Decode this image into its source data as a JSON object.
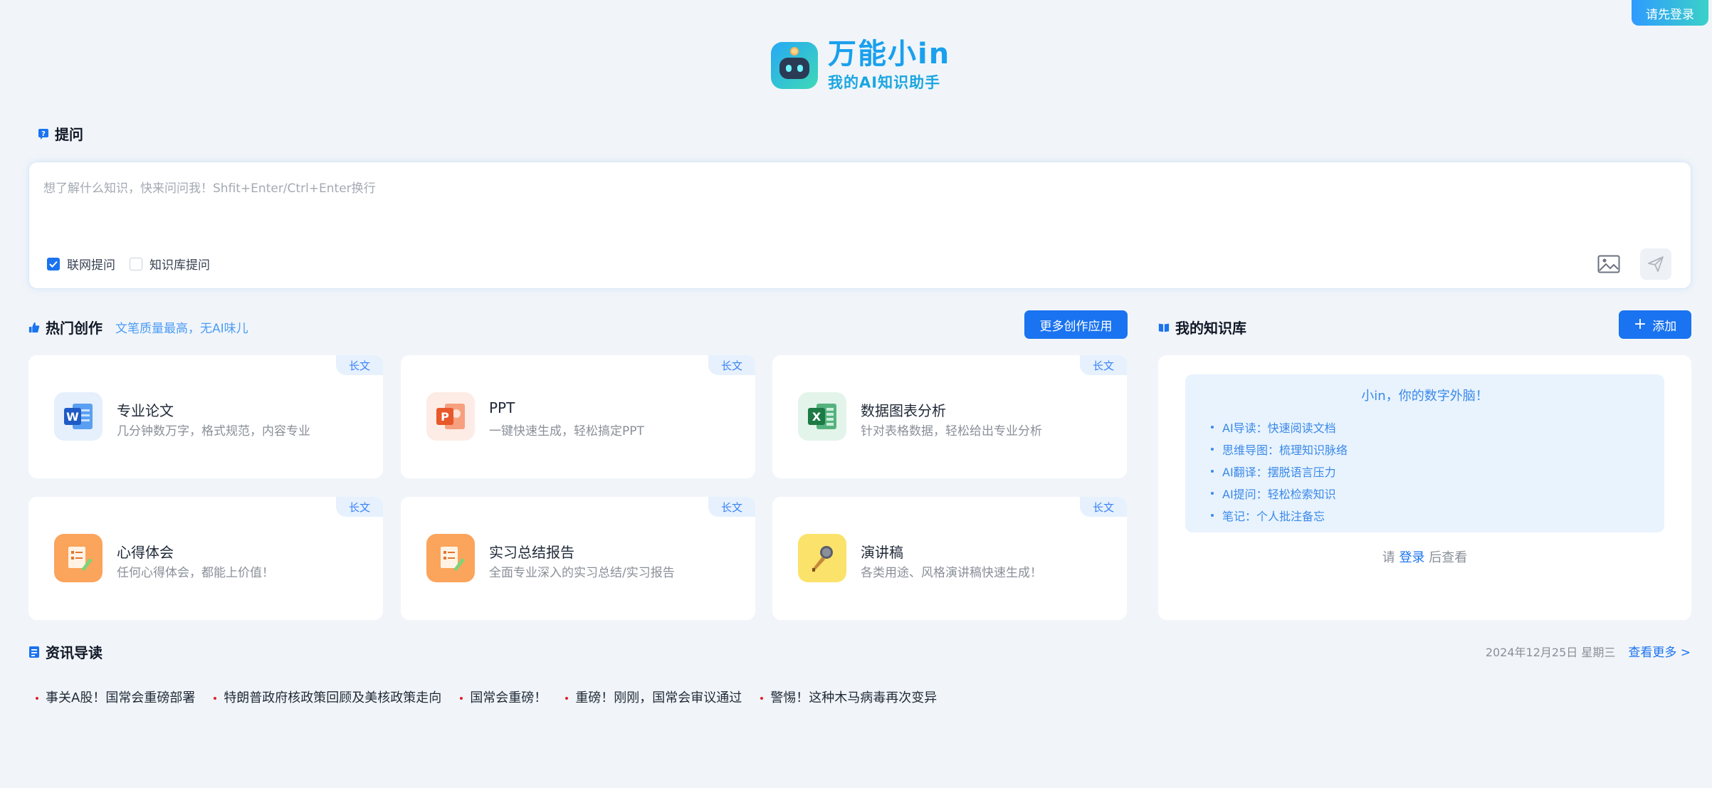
{
  "header": {
    "login_button": "请先登录",
    "logo_title": "万能小in",
    "logo_subtitle": "我的AI知识助手"
  },
  "ask": {
    "section_title": "提问",
    "placeholder": "想了解什么知识，快来问问我！Shfit+Enter/Ctrl+Enter换行",
    "options": [
      {
        "label": "联网提问",
        "checked": true
      },
      {
        "label": "知识库提问",
        "checked": false
      }
    ]
  },
  "hot": {
    "section_title": "热门创作",
    "subtitle": "文笔质量最高，无AI味儿",
    "more_button": "更多创作应用",
    "cards": [
      {
        "tag": "长文",
        "title": "专业论文",
        "desc": "几分钟数万字，格式规范，内容专业",
        "icon": "word-icon"
      },
      {
        "tag": "长文",
        "title": "PPT",
        "desc": "一键快速生成，轻松搞定PPT",
        "icon": "ppt-icon"
      },
      {
        "tag": "长文",
        "title": "数据图表分析",
        "desc": "针对表格数据，轻松给出专业分析",
        "icon": "excel-icon"
      },
      {
        "tag": "长文",
        "title": "心得体会",
        "desc": "任何心得体会，都能上价值！",
        "icon": "document-pen-icon"
      },
      {
        "tag": "长文",
        "title": "实习总结报告",
        "desc": "全面专业深入的实习总结/实习报告",
        "icon": "document-pen-icon"
      },
      {
        "tag": "长文",
        "title": "演讲稿",
        "desc": "各类用途、风格演讲稿快速生成！",
        "icon": "microphone-icon"
      }
    ]
  },
  "kb": {
    "section_title": "我的知识库",
    "add_button": "添加",
    "intro_title": "小in，你的数字外脑！",
    "features": [
      "AI导读：快速阅读文档",
      "思维导图：梳理知识脉络",
      "AI翻译：摆脱语言压力",
      "AI提问：轻松检索知识",
      "笔记：个人批注备忘"
    ],
    "hint_prefix": "请",
    "hint_link": "登录",
    "hint_suffix": "后查看"
  },
  "news": {
    "section_title": "资讯导读",
    "date": "2024年12月25日 星期三",
    "more_link": "查看更多 >",
    "items": [
      "事关A股！国常会重磅部署",
      "特朗普政府核政策回顾及美核政策走向",
      "国常会重磅！",
      "重磅！刚刚，国常会审议通过",
      "警惕！这种木马病毒再次变异"
    ]
  }
}
